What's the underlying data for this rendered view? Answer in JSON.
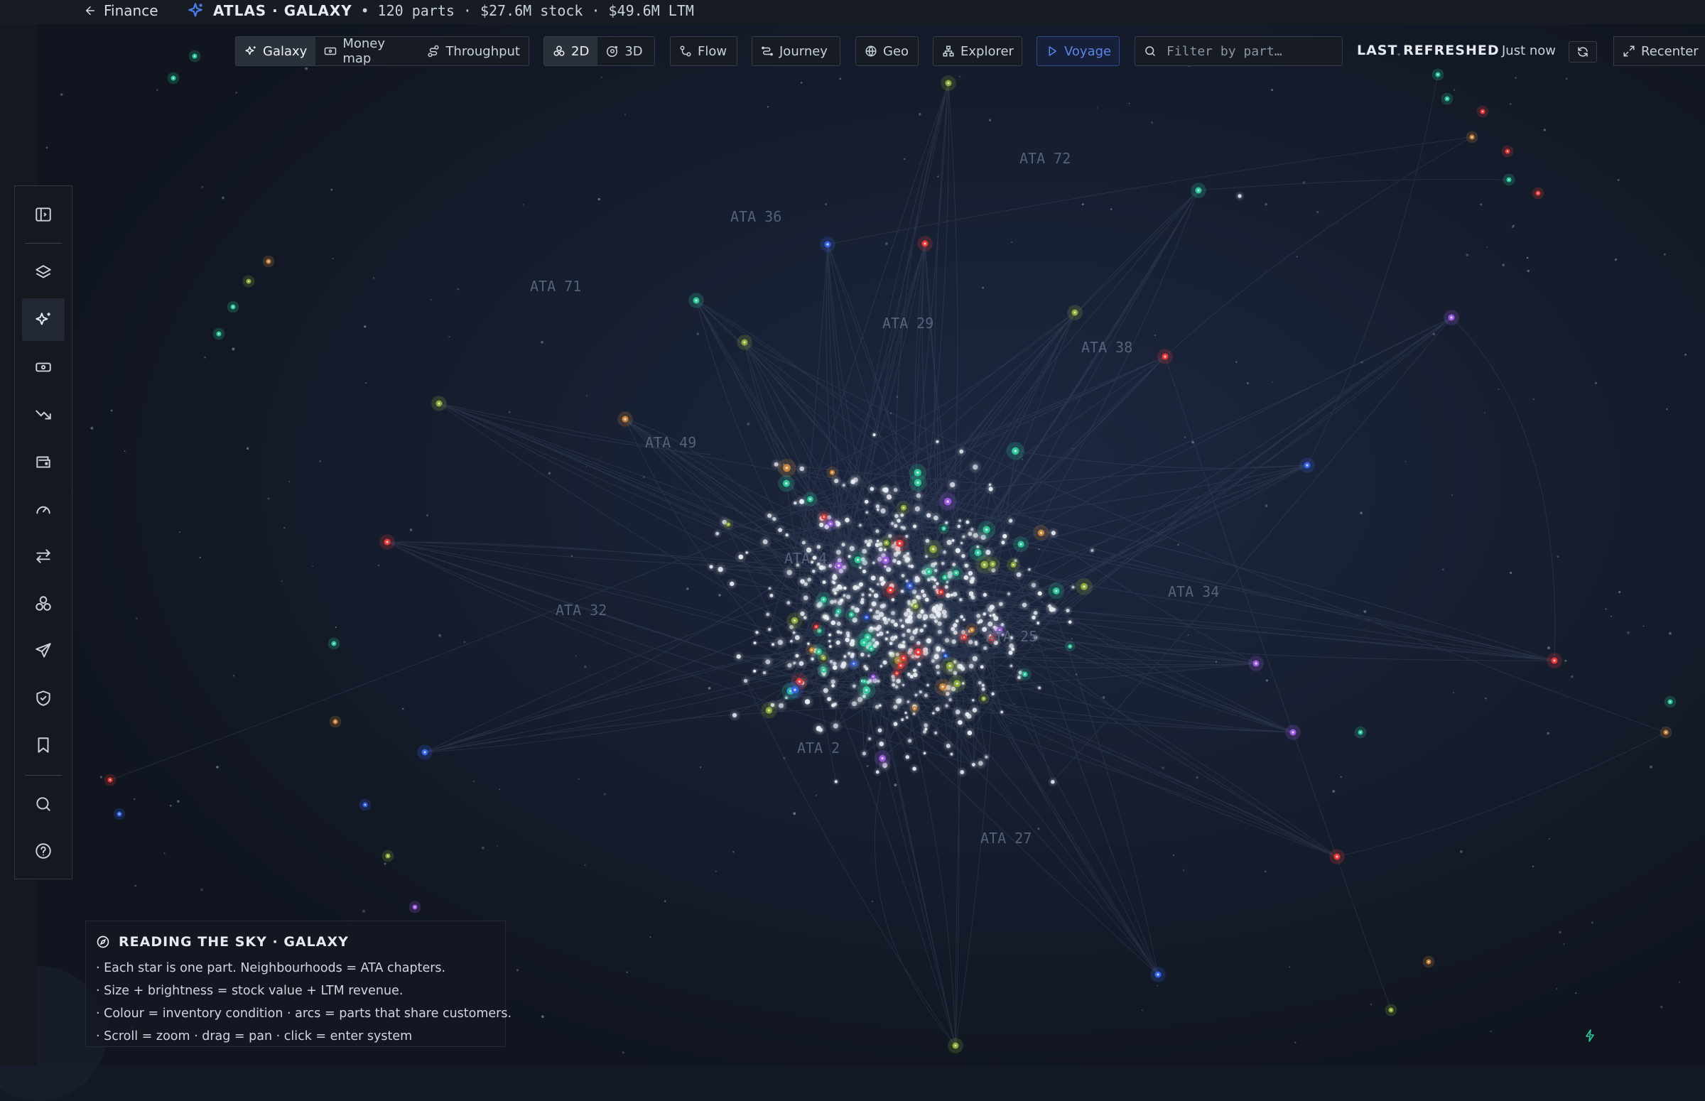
{
  "topbar": {
    "back_label": "Finance",
    "title": "ATLAS · GALAXY",
    "parts": "120 parts",
    "stock": "$27.6M stock",
    "ltm": "$49.6M LTM"
  },
  "toolbar": {
    "views": [
      {
        "label": "Galaxy",
        "icon": "sparkles-icon",
        "active": true
      },
      {
        "label": "Money map",
        "icon": "banknote-icon",
        "active": false
      },
      {
        "label": "Throughput",
        "icon": "route-icon",
        "active": false
      }
    ],
    "dims": [
      {
        "label": "2D",
        "icon": "circles-icon",
        "active": true
      },
      {
        "label": "3D",
        "icon": "orbit-icon",
        "active": false
      }
    ],
    "flow": "Flow",
    "journey": "Journey",
    "geo": "Geo",
    "explorer": "Explorer",
    "voyage": "Voyage"
  },
  "search": {
    "placeholder": "Filter by part…",
    "value": ""
  },
  "refresh": {
    "label": "LAST REFRESHED",
    "value": "Just now"
  },
  "recenter_label": "Recenter",
  "sidebar": {
    "items": [
      {
        "name": "collapse",
        "icon": "panel-toggle-icon"
      },
      {
        "name": "layers",
        "icon": "layers-icon"
      },
      {
        "name": "galaxy",
        "icon": "sparkles-icon",
        "active": true
      },
      {
        "name": "money",
        "icon": "banknote-icon"
      },
      {
        "name": "trend",
        "icon": "trending-down-icon"
      },
      {
        "name": "wallet",
        "icon": "wallet-icon"
      },
      {
        "name": "gauge",
        "icon": "gauge-icon"
      },
      {
        "name": "transfer",
        "icon": "arrows-swap-icon"
      },
      {
        "name": "network",
        "icon": "circles-icon"
      },
      {
        "name": "aircraft",
        "icon": "plane-icon"
      },
      {
        "name": "security",
        "icon": "shield-check-icon"
      },
      {
        "name": "bookmarks",
        "icon": "bookmark-icon"
      },
      {
        "name": "search",
        "icon": "search-icon"
      },
      {
        "name": "help",
        "icon": "help-circle-icon"
      }
    ]
  },
  "map": {
    "chapter_labels": [
      "ATA 72",
      "ATA 36",
      "ATA 71",
      "ATA 29",
      "ATA 38",
      "ATA 49",
      "ATA 4",
      "ATA 34",
      "ATA 32",
      "ATA 25",
      "ATA 2",
      "ATA 27"
    ],
    "status_colors": {
      "healthy": "#2ec79a",
      "slow": "#8fa83a",
      "critical": "#e53a3a",
      "warning": "#c8853a",
      "ordered": "#3566e8",
      "special": "#9b5ce0",
      "neutral": "#e8edf5"
    }
  },
  "legend": {
    "title": "READING THE SKY · GALAXY",
    "lines": [
      "· Each star is one part. Neighbourhoods = ATA chapters.",
      "· Size + brightness = stock value + LTM revenue.",
      "· Colour = inventory condition · arcs = parts that share customers.",
      "· Scroll = zoom · drag = pan · click = enter system"
    ]
  },
  "colors": {
    "background": "#121826",
    "accent": "#3566e8",
    "panel": "#161b24"
  }
}
